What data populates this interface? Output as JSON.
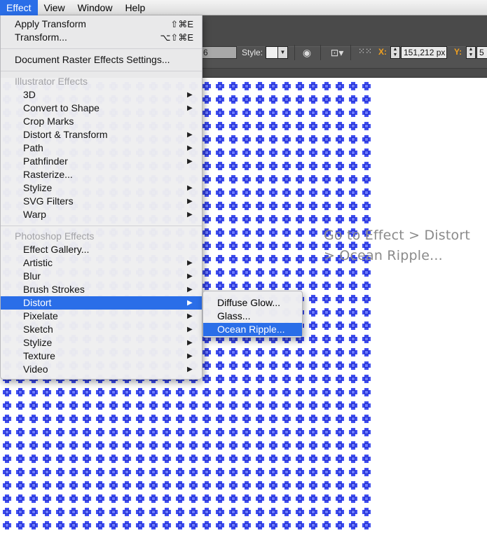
{
  "menubar": {
    "items": [
      "Effect",
      "View",
      "Window",
      "Help"
    ]
  },
  "controlbar": {
    "field_stub": "6",
    "style_label": "Style:",
    "x_label": "X:",
    "x_value": "151,212 px",
    "y_label": "Y:",
    "y_value": "5"
  },
  "effect_menu": {
    "apply_transform": "Apply Transform",
    "apply_transform_shortcut": "⇧⌘E",
    "transform": "Transform...",
    "transform_shortcut": "⌥⇧⌘E",
    "document_raster": "Document Raster Effects Settings...",
    "illustrator_header": "Illustrator Effects",
    "illustrator_items": [
      "3D",
      "Convert to Shape",
      "Crop Marks",
      "Distort & Transform",
      "Path",
      "Pathfinder",
      "Rasterize...",
      "Stylize",
      "SVG Filters",
      "Warp"
    ],
    "photoshop_header": "Photoshop Effects",
    "photoshop_items": [
      "Effect Gallery...",
      "Artistic",
      "Blur",
      "Brush Strokes",
      "Distort",
      "Pixelate",
      "Sketch",
      "Stylize",
      "Texture",
      "Video"
    ]
  },
  "distort_submenu": {
    "items": [
      "Diffuse Glow...",
      "Glass...",
      "Ocean Ripple..."
    ]
  },
  "caption": {
    "line1": "Go to Effect > Distort",
    "line2": "> Ocean Ripple..."
  },
  "colors": {
    "accent": "#2a6ee8",
    "pattern_light": "#4a5af5",
    "pattern_dark": "#1f2bc8"
  }
}
